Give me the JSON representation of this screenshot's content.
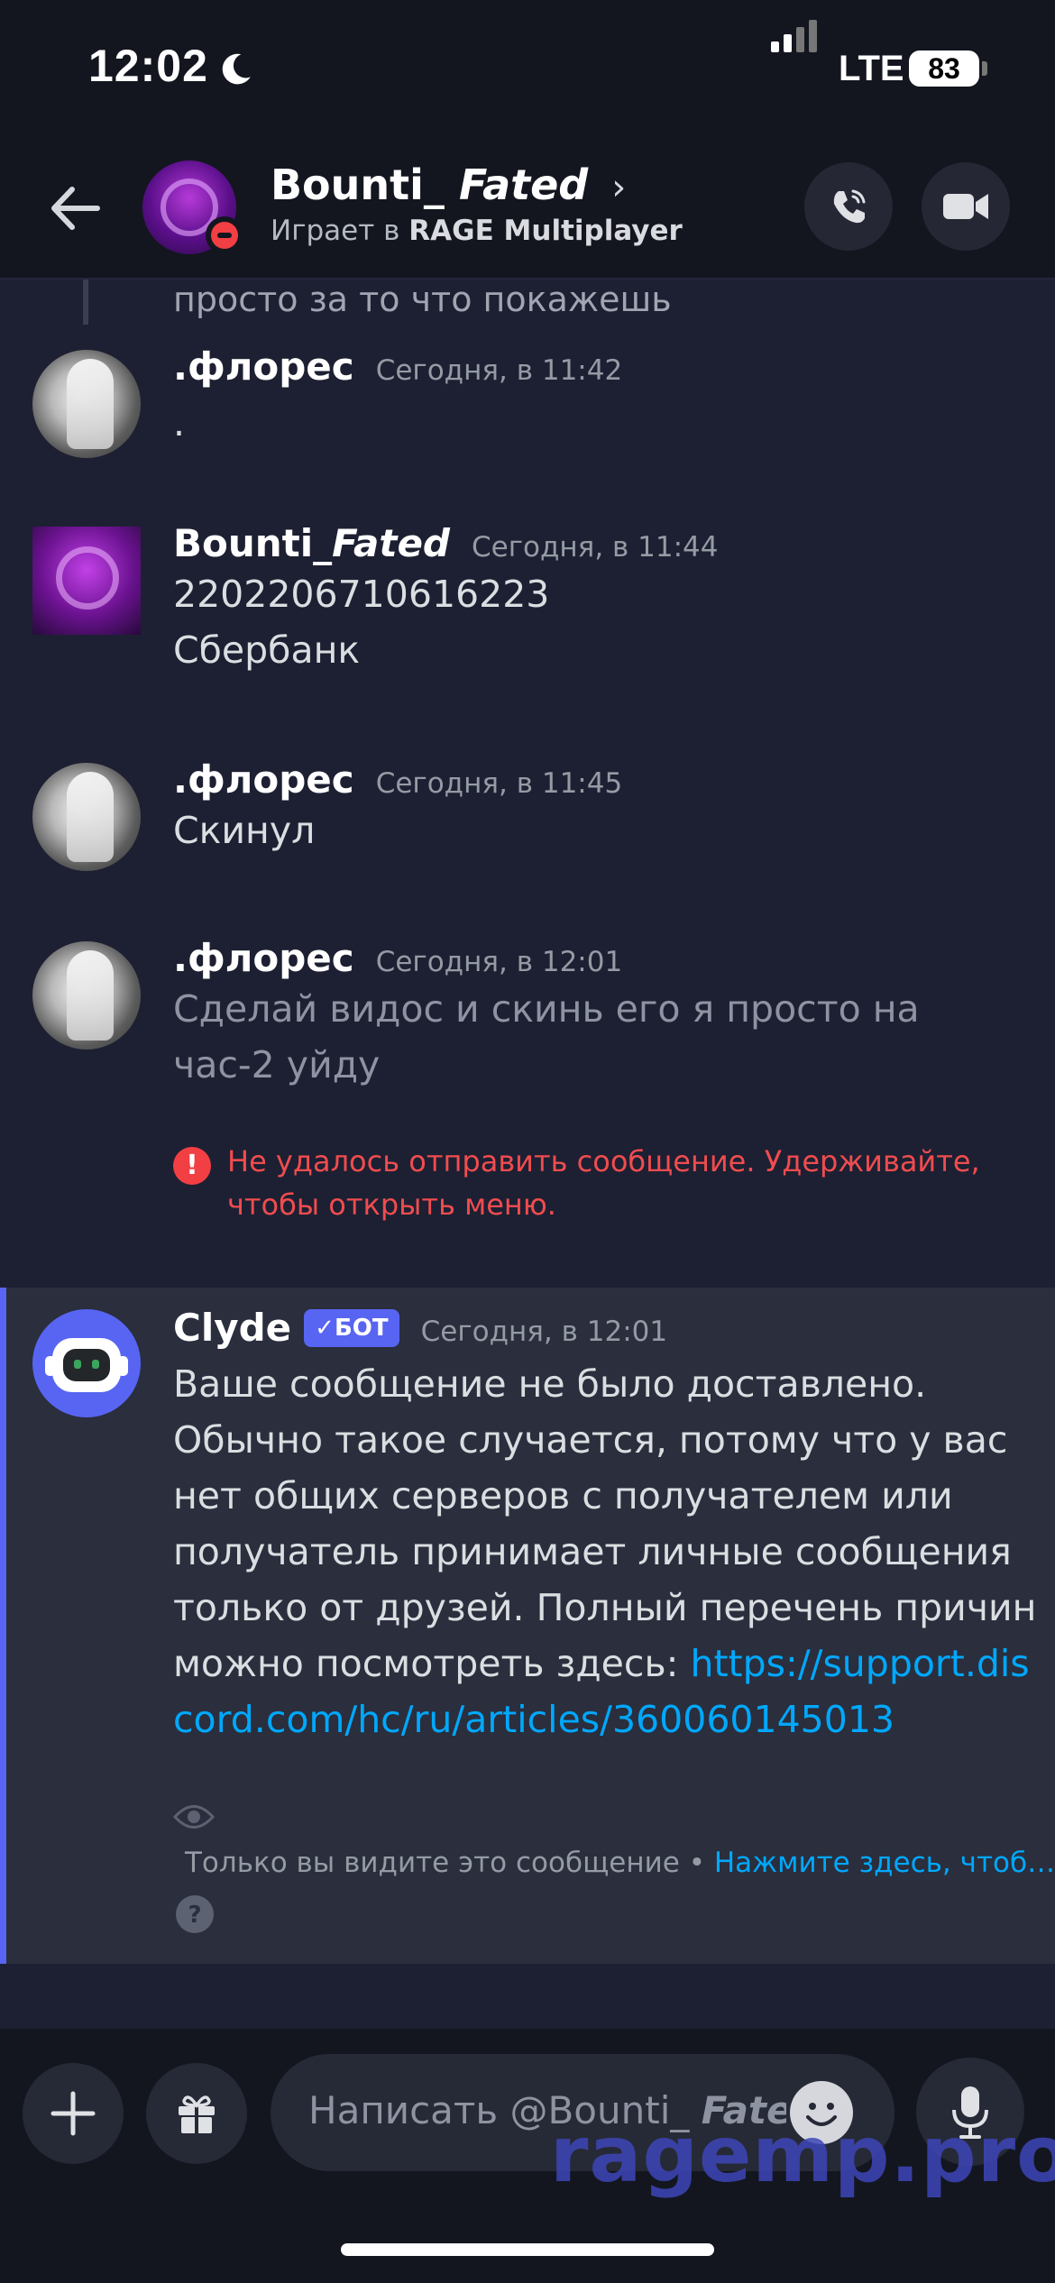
{
  "status_bar": {
    "time": "12:02",
    "network": "LTE",
    "battery": "83"
  },
  "header": {
    "name": "Bounti_",
    "name_italic": "Fated",
    "chevron": "›",
    "status_prefix": "Играет в",
    "status_game": "RAGE Multiplayer"
  },
  "chat": {
    "cut_off_text": "просто за то что покажешь",
    "messages": [
      {
        "author": ".флорес",
        "time": "Сегодня, в 11:42",
        "lines": [
          "."
        ]
      },
      {
        "author": "Bounti_",
        "author_italic": "Fated",
        "time": "Сегодня, в 11:44",
        "lines": [
          "2202206710616223",
          "Сбербанк"
        ]
      },
      {
        "author": ".флорес",
        "time": "Сегодня, в 11:45",
        "lines": [
          "Скинул"
        ]
      },
      {
        "author": ".флорес",
        "time": "Сегодня, в 12:01",
        "lines": [
          "Сделай видос и скинь его я просто на час-2 уйду"
        ]
      }
    ],
    "error": {
      "icon": "!",
      "text": "Не удалось отправить сообщение. Удерживайте, чтобы открыть меню."
    },
    "clyde": {
      "author": "Clyde",
      "badge": "✓БОТ",
      "time": "Сегодня, в 12:01",
      "text": "Ваше сообщение не было доставлено. Обычно такое случается, потому что у вас нет общих серверов с получателем или получатель принимает личные сообщения только от друзей. Полный перечень причин можно посмотреть здесь:",
      "link": "https://support.discord.com/hc/ru/articles/360060145013",
      "ephemeral_text": "Только вы видите это сообщение •",
      "ephemeral_link": "Нажмите здесь, чтоб…"
    }
  },
  "composer": {
    "placeholder": "Написать @Bounti_",
    "placeholder_italic": "Fated"
  },
  "watermark": "ragemp.pro",
  "colors": {
    "accent": "#5865f2",
    "error": "#f23f43",
    "link": "#00a8fc",
    "background": "#1d2032"
  }
}
